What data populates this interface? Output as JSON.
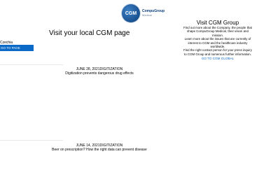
{
  "logo": {
    "initials": "CGM",
    "name": "CompuGroup",
    "sub": "Medical"
  },
  "local": {
    "title": "Visit your local CGM page",
    "country": "Czechia",
    "button_label": "GO TO PAGE"
  },
  "group": {
    "title": "Visit CGM Group",
    "p1": "Find out more about the Company, the people that shape CompuGroup Medical, their vision and mission.",
    "p2": "Learn more about the issues that are currently of interest to CGM and the healthcare industry worldwide.",
    "p3": "Find the right contact person for your press inquiry to CGM Group and numerous further information.",
    "link_label": "GO TO CGM GLOBAL"
  },
  "news": [
    {
      "date": "JUNE 28, 2021DIGITIZATION",
      "title": "Digitization prevents dangerous drug effects"
    },
    {
      "date": "JUNE 14, 2021DIGITIZATION",
      "title": "Beer on prescription? How the right data can prevent disease"
    }
  ]
}
